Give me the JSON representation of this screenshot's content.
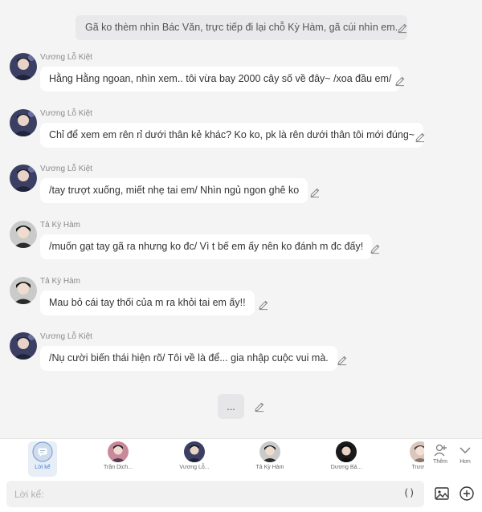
{
  "narration": "Gã ko thèm nhìn Bác Văn, trực tiếp đi lại chỗ Kỳ Hàm, gã cúi nhìn em.",
  "messages": [
    {
      "name": "Vương Lỗ Kiệt",
      "text": "Hằng Hằng ngoan, nhìn xem.. tôi vừa bay 2000 cây số về đây~ /xoa đầu em/"
    },
    {
      "name": "Vương Lỗ Kiệt",
      "text": "Chỉ để xem em rên rỉ dưới thân kẻ khác? Ko ko, pk là rên dưới thân tôi mới đúng~"
    },
    {
      "name": "Vương Lỗ Kiệt",
      "text": "/tay trượt xuống, miết nhẹ tai em/ Nhìn ngủ ngon ghê ko"
    },
    {
      "name": "Tả Kỳ Hàm",
      "text": "/muốn gạt tay gã ra nhưng ko đc/ Vì t bế em ấy nên ko đánh m đc đấy!"
    },
    {
      "name": "Tả Kỳ Hàm",
      "text": "Mau bỏ cái tay thối của m ra khỏi tai em ấy!!"
    },
    {
      "name": "Vương Lỗ Kiệt",
      "text": "/Nụ cười biến thái hiện rõ/ Tôi về là để... gia nhập cuộc vui mà."
    }
  ],
  "pending": "...",
  "characters": [
    {
      "label": "Lời kể"
    },
    {
      "label": "Trần Dịch..."
    },
    {
      "label": "Vương Lỗ..."
    },
    {
      "label": "Tả Kỳ Hàm"
    },
    {
      "label": "Dương Bá..."
    },
    {
      "label": "Trươ"
    }
  ],
  "tools": {
    "add_label": "Thêm",
    "more_label": "Hơn"
  },
  "input": {
    "placeholder": "Lời kể:",
    "paren": "()"
  },
  "icons": {
    "edit": "pencil-icon",
    "image": "image-icon",
    "plus": "plus-circle-icon",
    "add_person": "person-add-icon",
    "more": "chevron-down-icon"
  }
}
